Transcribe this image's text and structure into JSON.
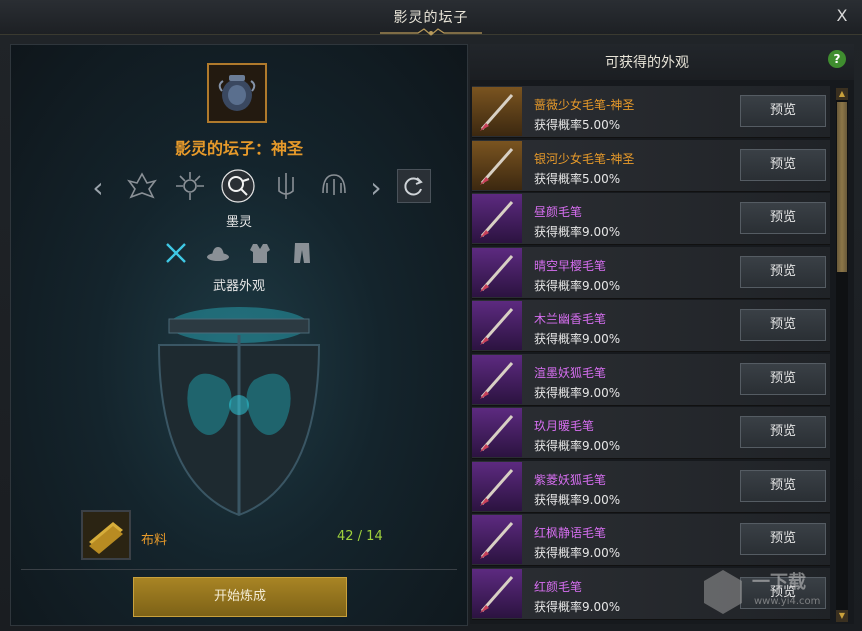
{
  "window": {
    "title": "影灵的坛子",
    "close_label": "X"
  },
  "left": {
    "item_name": "影灵的坛子：神圣",
    "selected_class": "墨灵",
    "selected_slot": "武器外观",
    "material": {
      "name": "布料",
      "count": "42 / 14"
    },
    "start_button": "开始炼成",
    "class_icons": [
      "class-icon-1",
      "class-icon-2",
      "class-icon-moling",
      "class-icon-4",
      "class-icon-5"
    ],
    "slot_icons": [
      "weapon-icon",
      "hat-icon",
      "armor-icon",
      "pants-icon"
    ]
  },
  "right": {
    "title": "可获得的外观",
    "help_label": "?",
    "preview_label": "预览",
    "items": [
      {
        "name": "蔷薇少女毛笔-神圣",
        "rate": "获得概率5.00%",
        "rarity": "gold"
      },
      {
        "name": "银河少女毛笔-神圣",
        "rate": "获得概率5.00%",
        "rarity": "gold"
      },
      {
        "name": "昼颜毛笔",
        "rate": "获得概率9.00%",
        "rarity": "purple"
      },
      {
        "name": "晴空早樱毛笔",
        "rate": "获得概率9.00%",
        "rarity": "purple"
      },
      {
        "name": "木兰幽香毛笔",
        "rate": "获得概率9.00%",
        "rarity": "purple"
      },
      {
        "name": "渲墨妖狐毛笔",
        "rate": "获得概率9.00%",
        "rarity": "purple"
      },
      {
        "name": "玖月暖毛笔",
        "rate": "获得概率9.00%",
        "rarity": "purple"
      },
      {
        "name": "紫菱妖狐毛笔",
        "rate": "获得概率9.00%",
        "rarity": "purple"
      },
      {
        "name": "红枫静语毛笔",
        "rate": "获得概率9.00%",
        "rarity": "purple"
      },
      {
        "name": "红颜毛笔",
        "rate": "获得概率9.00%",
        "rarity": "purple"
      }
    ]
  },
  "watermark": {
    "text": "一下载",
    "url": "www.yi4.com"
  },
  "colors": {
    "gold": "#e79a2a",
    "purple": "#d66ef0",
    "count_green": "#9fd23c",
    "accent_teal": "#2fd6e8"
  }
}
